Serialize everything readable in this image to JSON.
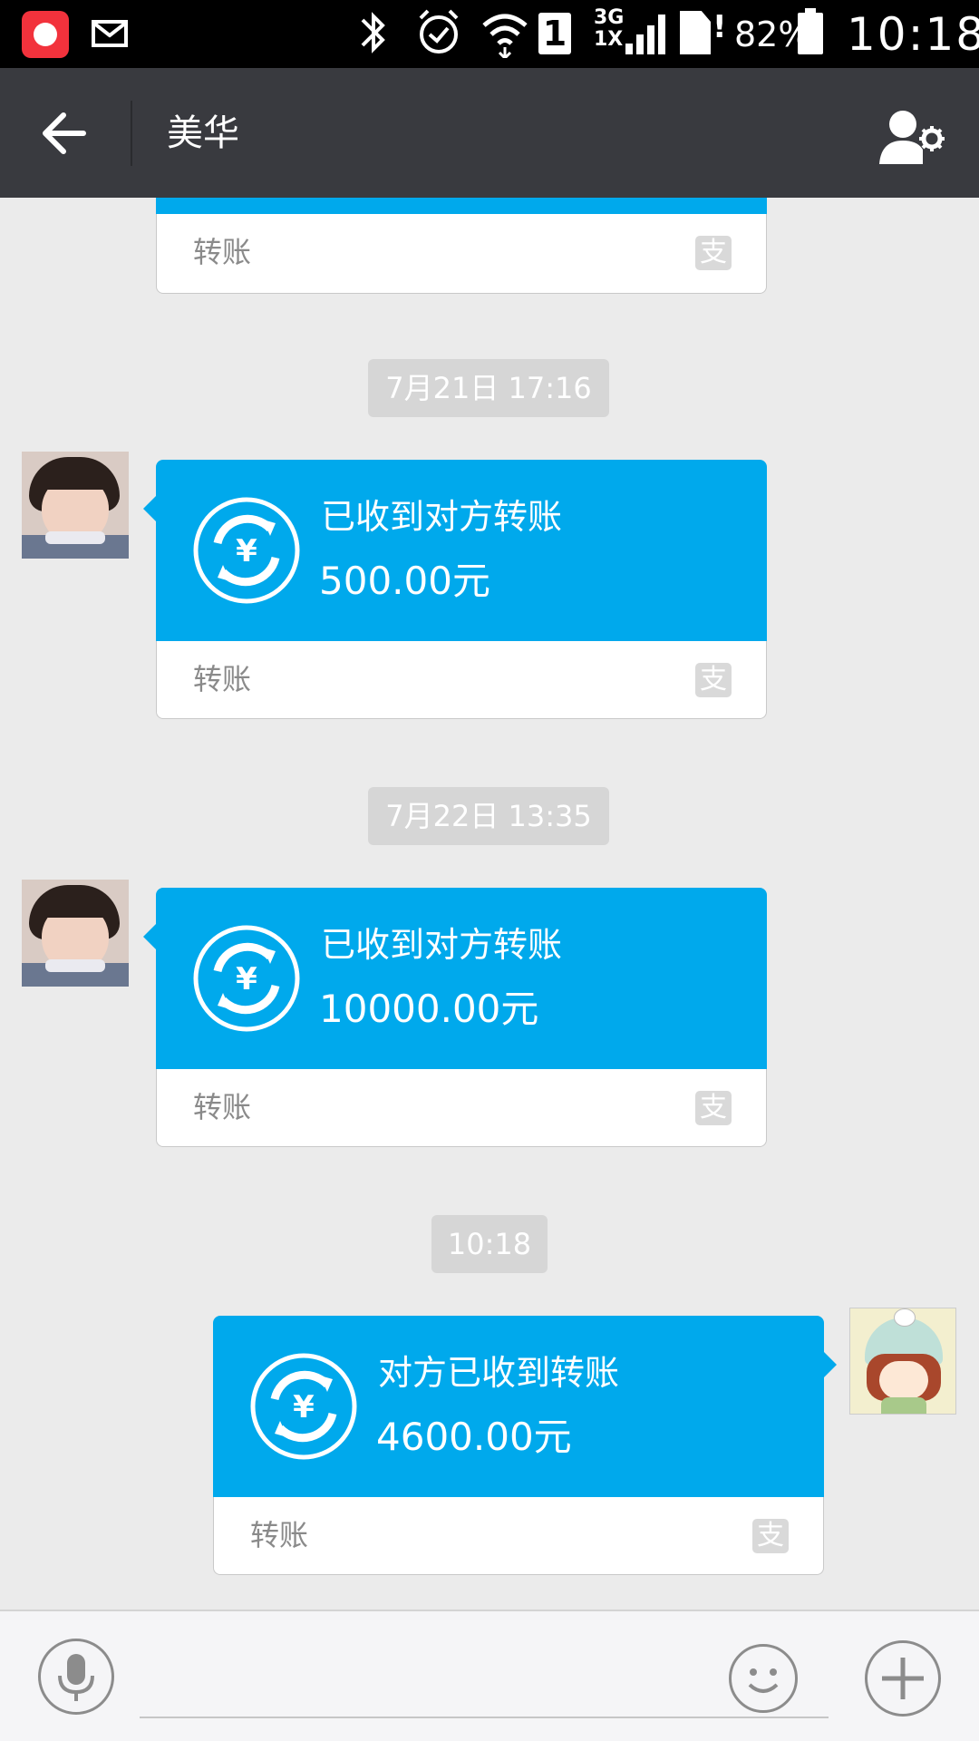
{
  "status_bar": {
    "signal_label": "3G\n1X",
    "carrier_slot": "1",
    "battery": "82%",
    "time": "10:18"
  },
  "header": {
    "title": "美华"
  },
  "chat": {
    "partial_card": {
      "footer_label": "转账",
      "pay_icon_char": "支"
    },
    "timestamps": [
      "7月21日 17:16",
      "7月22日 13:35",
      "10:18"
    ],
    "messages": [
      {
        "side": "left",
        "title": "已收到对方转账",
        "amount": "500.00元",
        "footer_label": "转账",
        "pay_icon_char": "支"
      },
      {
        "side": "left",
        "title": "已收到对方转账",
        "amount": "10000.00元",
        "footer_label": "转账",
        "pay_icon_char": "支"
      },
      {
        "side": "right",
        "title": "对方已收到转账",
        "amount": "4600.00元",
        "footer_label": "转账",
        "pay_icon_char": "支"
      }
    ]
  },
  "input_bar": {
    "text_value": ""
  },
  "colors": {
    "accent": "#00a9ec",
    "header_bg": "#393a3f",
    "chat_bg": "#ebebeb"
  }
}
